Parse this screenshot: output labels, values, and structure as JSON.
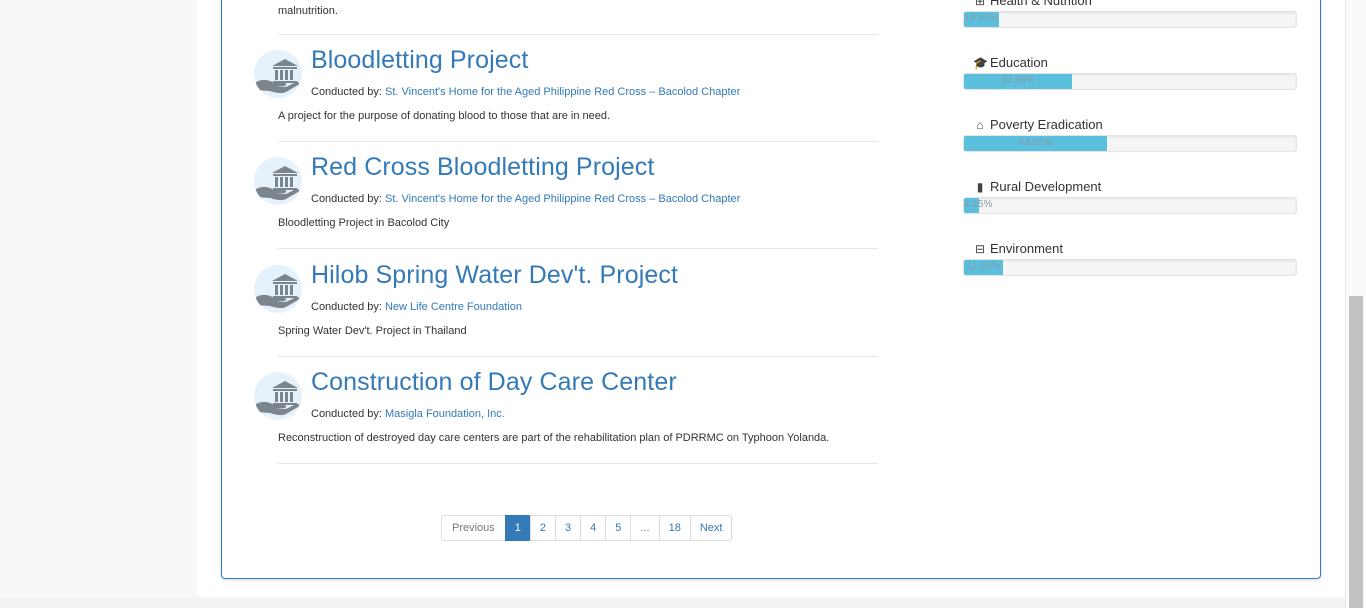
{
  "top_snippet": "malnutrition.",
  "projects": [
    {
      "title": "Bloodletting Project",
      "conducted_by_label": "Conducted by:",
      "organization": "St. Vincent's Home for the Aged Philippine Red Cross – Bacolod Chapter",
      "description": "A project for the purpose of donating blood to those that are in need."
    },
    {
      "title": "Red Cross Bloodletting Project",
      "conducted_by_label": "Conducted by:",
      "organization": "St. Vincent's Home for the Aged Philippine Red Cross – Bacolod Chapter",
      "description": "Bloodletting Project in Bacolod City"
    },
    {
      "title": "Hilob Spring Water Dev't. Project",
      "conducted_by_label": "Conducted by:",
      "organization": "New Life Centre Foundation",
      "description": "Spring Water Dev't. Project in Thailand"
    },
    {
      "title": "Construction of Day Care Center",
      "conducted_by_label": "Conducted by:",
      "organization": "Masigla Foundation, Inc.",
      "description": "Reconstruction of destroyed day care centers are part of the rehabilitation plan of PDRRMC on Typhoon Yolanda."
    }
  ],
  "categories": [
    {
      "icon": "medkit-icon",
      "label": "Health & Nutrition",
      "percent_text": "10.47%",
      "value": 10.47
    },
    {
      "icon": "graduation-cap-icon",
      "label": "Education",
      "percent_text": "32.56%",
      "value": 32.56
    },
    {
      "icon": "home-icon",
      "label": "Poverty Eradication",
      "percent_text": "43.02%",
      "value": 43.02
    },
    {
      "icon": "building-icon",
      "label": "Rural Development",
      "percent_text": "4.65%",
      "value": 4.65
    },
    {
      "icon": "basket-icon",
      "label": "Environment",
      "percent_text": "11.63%",
      "value": 11.63
    }
  ],
  "pagination": {
    "previous": "Previous",
    "pages": [
      "1",
      "2",
      "3",
      "4",
      "5",
      "...",
      "18"
    ],
    "active": "1",
    "next": "Next"
  },
  "colors": {
    "link": "#337ab7",
    "progress": "#5bc0de",
    "panel_border": "#337ab7"
  }
}
